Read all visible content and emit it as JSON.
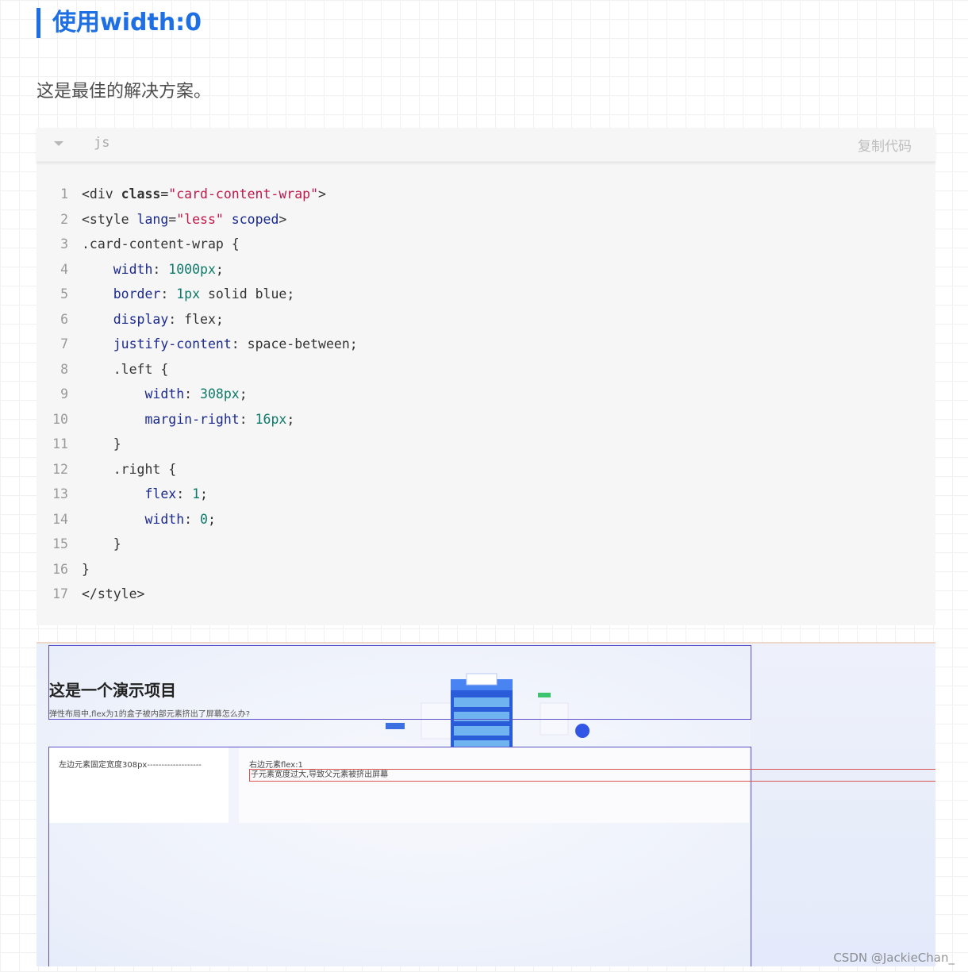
{
  "heading": "使用width:0",
  "intro": "这是最佳的解决方案。",
  "code_block": {
    "language": "js",
    "copy_label": "复制代码",
    "lines": [
      {
        "num": "1",
        "indent": "",
        "tokens": [
          {
            "t": "tag",
            "v": "<div "
          },
          {
            "t": "kw",
            "v": "class"
          },
          {
            "t": "punc",
            "v": "="
          },
          {
            "t": "str",
            "v": "\"card-content-wrap\""
          },
          {
            "t": "tag",
            "v": ">"
          }
        ]
      },
      {
        "num": "2",
        "indent": "",
        "tokens": [
          {
            "t": "tag",
            "v": "<style "
          },
          {
            "t": "attr",
            "v": "lang"
          },
          {
            "t": "punc",
            "v": "="
          },
          {
            "t": "str",
            "v": "\"less\""
          },
          {
            "t": "tag",
            "v": " "
          },
          {
            "t": "attr",
            "v": "scoped"
          },
          {
            "t": "tag",
            "v": ">"
          }
        ]
      },
      {
        "num": "3",
        "indent": "",
        "tokens": [
          {
            "t": "sel",
            "v": ".card-content-wrap {"
          }
        ]
      },
      {
        "num": "4",
        "indent": "    ",
        "tokens": [
          {
            "t": "attr",
            "v": "width"
          },
          {
            "t": "punc",
            "v": ": "
          },
          {
            "t": "num",
            "v": "1000px"
          },
          {
            "t": "punc",
            "v": ";"
          }
        ]
      },
      {
        "num": "5",
        "indent": "    ",
        "tokens": [
          {
            "t": "attr",
            "v": "border"
          },
          {
            "t": "punc",
            "v": ": "
          },
          {
            "t": "num",
            "v": "1px"
          },
          {
            "t": "val",
            "v": " solid blue;"
          }
        ]
      },
      {
        "num": "6",
        "indent": "    ",
        "tokens": [
          {
            "t": "attr",
            "v": "display"
          },
          {
            "t": "punc",
            "v": ": "
          },
          {
            "t": "val",
            "v": "flex;"
          }
        ]
      },
      {
        "num": "7",
        "indent": "    ",
        "tokens": [
          {
            "t": "attr",
            "v": "justify-content"
          },
          {
            "t": "punc",
            "v": ": "
          },
          {
            "t": "val",
            "v": "space-between;"
          }
        ]
      },
      {
        "num": "8",
        "indent": "    ",
        "tokens": [
          {
            "t": "sel",
            "v": ".left {"
          }
        ]
      },
      {
        "num": "9",
        "indent": "        ",
        "tokens": [
          {
            "t": "attr",
            "v": "width"
          },
          {
            "t": "punc",
            "v": ": "
          },
          {
            "t": "num",
            "v": "308px"
          },
          {
            "t": "punc",
            "v": ";"
          }
        ]
      },
      {
        "num": "10",
        "indent": "        ",
        "tokens": [
          {
            "t": "attr",
            "v": "margin-right"
          },
          {
            "t": "punc",
            "v": ": "
          },
          {
            "t": "num",
            "v": "16px"
          },
          {
            "t": "punc",
            "v": ";"
          }
        ]
      },
      {
        "num": "11",
        "indent": "    ",
        "tokens": [
          {
            "t": "punc",
            "v": "}"
          }
        ]
      },
      {
        "num": "12",
        "indent": "    ",
        "tokens": [
          {
            "t": "sel",
            "v": ".right {"
          }
        ]
      },
      {
        "num": "13",
        "indent": "        ",
        "tokens": [
          {
            "t": "attr",
            "v": "flex"
          },
          {
            "t": "punc",
            "v": ": "
          },
          {
            "t": "num",
            "v": "1"
          },
          {
            "t": "punc",
            "v": ";"
          }
        ]
      },
      {
        "num": "14",
        "indent": "        ",
        "tokens": [
          {
            "t": "attr",
            "v": "width"
          },
          {
            "t": "punc",
            "v": ": "
          },
          {
            "t": "num",
            "v": "0"
          },
          {
            "t": "punc",
            "v": ";"
          }
        ]
      },
      {
        "num": "15",
        "indent": "    ",
        "tokens": [
          {
            "t": "punc",
            "v": "}"
          }
        ]
      },
      {
        "num": "16",
        "indent": "",
        "tokens": [
          {
            "t": "punc",
            "v": "}"
          }
        ]
      },
      {
        "num": "17",
        "indent": "",
        "tokens": [
          {
            "t": "tag",
            "v": "</style>"
          }
        ]
      }
    ]
  },
  "demo": {
    "title": "这是一个演示项目",
    "subtitle": "弹性布局中,flex为1的盒子被内部元素挤出了屏幕怎么办?",
    "left_card_text": "左边元素固定宽度308px-------------------",
    "right_card_text": "右边元素flex:1",
    "overflow_text": "子元素宽度过大,导致父元素被挤出屏幕"
  },
  "watermark": "CSDN @JackieChan_"
}
